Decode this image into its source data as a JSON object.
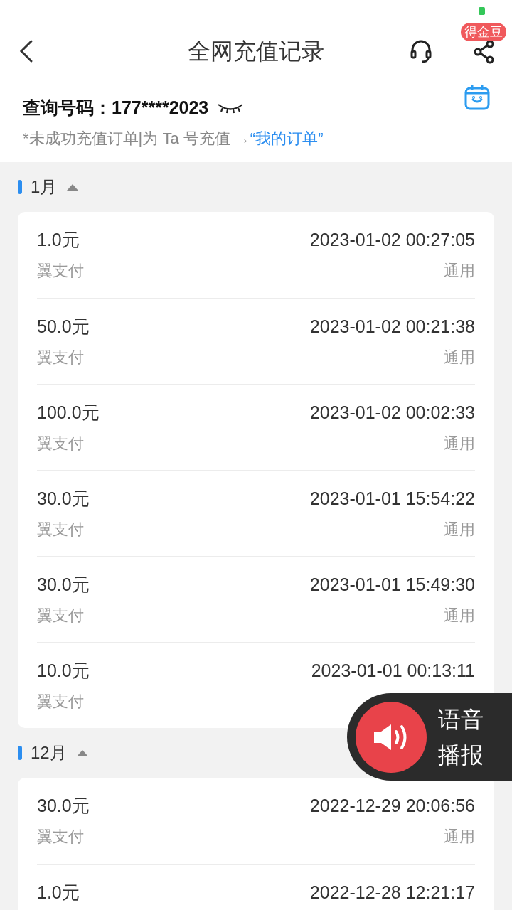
{
  "header": {
    "title": "全网充值记录",
    "badge": "得金豆"
  },
  "query": {
    "label": "查询号码：",
    "number": "177****2023",
    "note": "*未成功充值订单|为 Ta 号充值 →",
    "link": "“我的订单”"
  },
  "months": [
    {
      "label": "1月",
      "expanded": true,
      "records": [
        {
          "amount": "1.0元",
          "time": "2023-01-02 00:27:05",
          "method": "翼支付",
          "scope": "通用"
        },
        {
          "amount": "50.0元",
          "time": "2023-01-02 00:21:38",
          "method": "翼支付",
          "scope": "通用"
        },
        {
          "amount": "100.0元",
          "time": "2023-01-02 00:02:33",
          "method": "翼支付",
          "scope": "通用"
        },
        {
          "amount": "30.0元",
          "time": "2023-01-01 15:54:22",
          "method": "翼支付",
          "scope": "通用"
        },
        {
          "amount": "30.0元",
          "time": "2023-01-01 15:49:30",
          "method": "翼支付",
          "scope": "通用"
        },
        {
          "amount": "10.0元",
          "time": "2023-01-01 00:13:11",
          "method": "翼支付"
        }
      ]
    },
    {
      "label": "12月",
      "expanded": true,
      "records": [
        {
          "amount": "30.0元",
          "time": "2022-12-29 20:06:56",
          "method": "翼支付",
          "scope": "通用"
        },
        {
          "amount": "1.0元",
          "time": "2022-12-28 12:21:17"
        }
      ]
    }
  ],
  "voice": {
    "label_line1": "语音",
    "label_line2": "播报"
  }
}
